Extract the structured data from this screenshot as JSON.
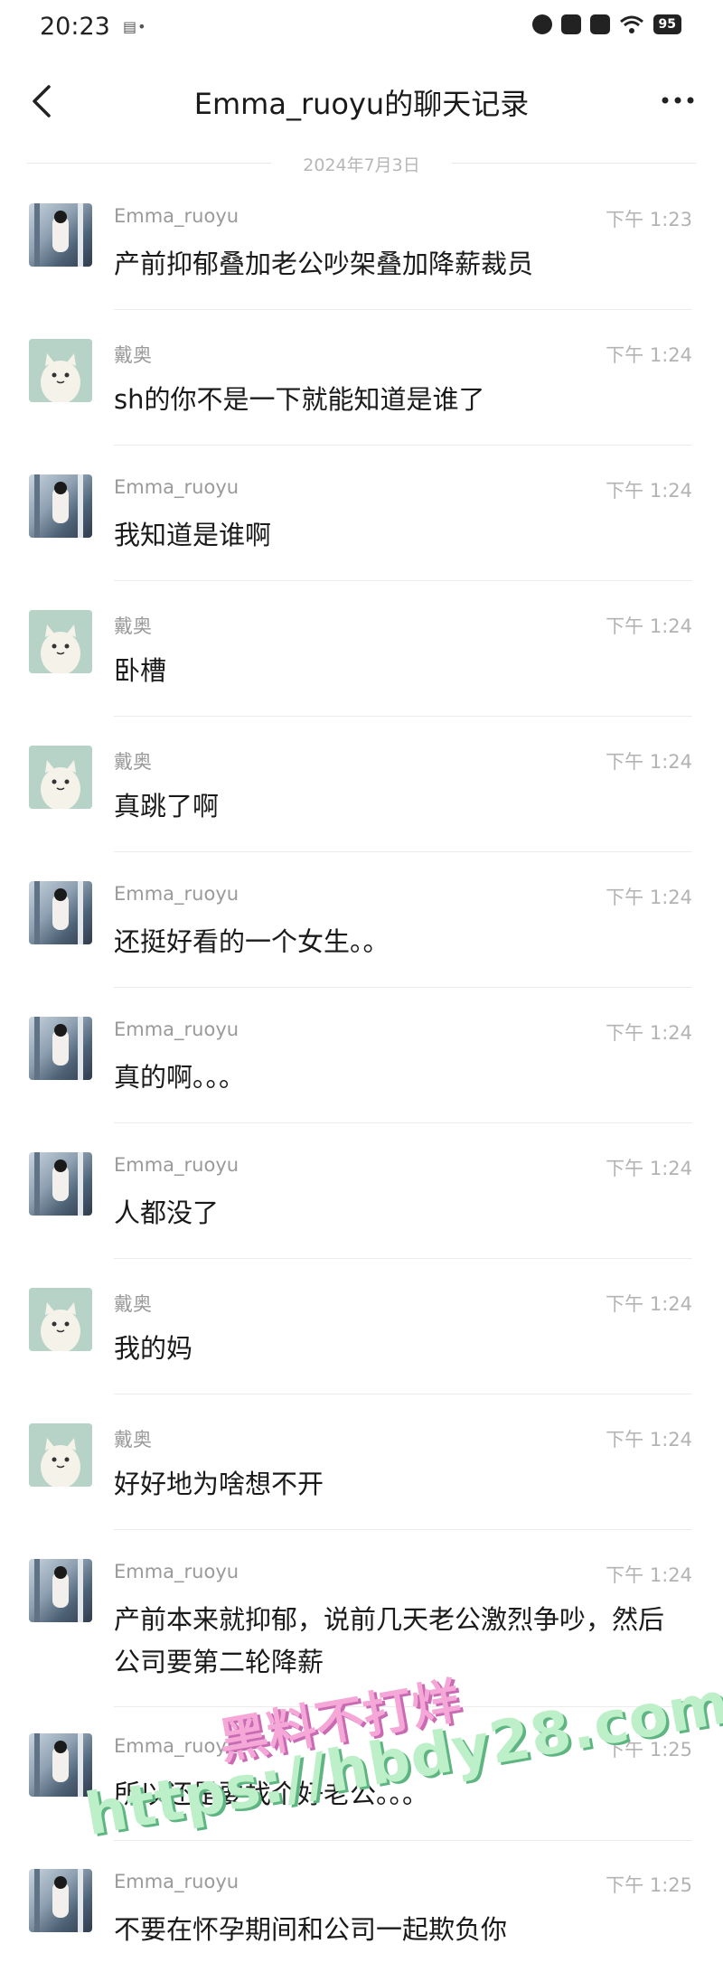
{
  "status": {
    "time": "20:23",
    "battery": "95"
  },
  "nav": {
    "title": "Emma_ruoyu的聊天记录"
  },
  "date_divider": "2024年7月3日",
  "messages": [
    {
      "name": "Emma_ruoyu",
      "time": "下午 1:23",
      "text": "产前抑郁叠加老公吵架叠加降薪裁员"
    },
    {
      "name": "戴奥",
      "time": "下午 1:24",
      "text": "sh的你不是一下就能知道是谁了"
    },
    {
      "name": "Emma_ruoyu",
      "time": "下午 1:24",
      "text": "我知道是谁啊"
    },
    {
      "name": "戴奥",
      "time": "下午 1:24",
      "text": "卧槽"
    },
    {
      "name": "戴奥",
      "time": "下午 1:24",
      "text": "真跳了啊"
    },
    {
      "name": "Emma_ruoyu",
      "time": "下午 1:24",
      "text": "还挺好看的一个女生。。"
    },
    {
      "name": "Emma_ruoyu",
      "time": "下午 1:24",
      "text": "真的啊。。。"
    },
    {
      "name": "Emma_ruoyu",
      "time": "下午 1:24",
      "text": "人都没了"
    },
    {
      "name": "戴奥",
      "time": "下午 1:24",
      "text": "我的妈"
    },
    {
      "name": "戴奥",
      "time": "下午 1:24",
      "text": "好好地为啥想不开"
    },
    {
      "name": "Emma_ruoyu",
      "time": "下午 1:24",
      "text": "产前本来就抑郁，说前几天老公激烈争吵，然后公司要第二轮降薪"
    },
    {
      "name": "Emma_ruoyu",
      "time": "下午 1:25",
      "text": "所以还是要找个好老公。。。"
    },
    {
      "name": "Emma_ruoyu",
      "time": "下午 1:25",
      "text": "不要在怀孕期间和公司一起欺负你"
    }
  ],
  "watermark": {
    "line1": "黑料不打烊",
    "line2": "https://hbdy28.com"
  }
}
